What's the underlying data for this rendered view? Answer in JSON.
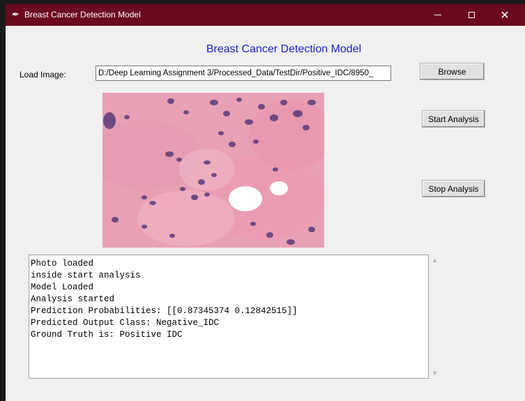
{
  "window": {
    "title": "Breast Cancer Detection Model",
    "title_icon": "feather-icon",
    "controls": {
      "minimize": "",
      "maximize": "",
      "close": "✕"
    }
  },
  "heading": "Breast Cancer Detection Model",
  "load": {
    "label": "Load Image:",
    "path": "D:/Deep Learning Assignment 3/Processed_Data/TestDir/Positive_IDC/8950_"
  },
  "buttons": {
    "browse": "Browse",
    "start": "Start Analysis",
    "stop": "Stop Analysis"
  },
  "console": {
    "lines": [
      "Photo loaded",
      "inside start analysis",
      "Model Loaded",
      "Analysis started",
      "Prediction Probabilities: [[0.87345374 0.12842515]]",
      "Predicted Output Class: Negative_IDC",
      "Ground Truth is: Positive IDC"
    ]
  },
  "colors": {
    "titlebar": "#6b0a1f",
    "heading": "#2020c8",
    "tissue": "#e8a0b4",
    "nuclei": "#5a3a7a"
  }
}
